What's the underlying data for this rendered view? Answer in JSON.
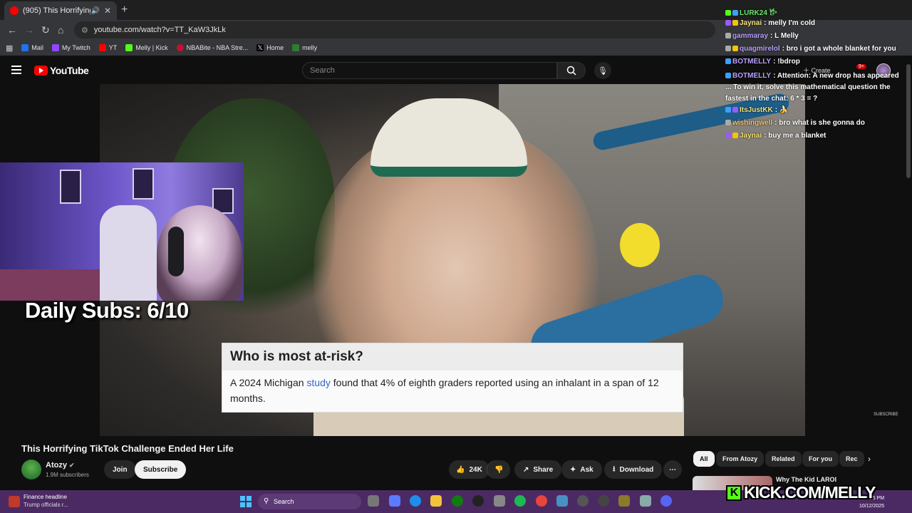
{
  "browser": {
    "tab_title": "(905) This Horrifying TikTok",
    "new_tab": "+",
    "url": "youtube.com/watch?v=TT_KaW3JkLk",
    "bookmarks": [
      "Mail",
      "My Twitch",
      "YT",
      "Melly | Kick",
      "NBABite - NBA Stre...",
      "Home",
      "melly"
    ]
  },
  "youtube": {
    "logo": "YouTube",
    "search_placeholder": "Search",
    "create_label": "Create",
    "notif_count": "9+"
  },
  "video": {
    "card_title": "Who is most at-risk?",
    "card_text_before": "A 2024 Michigan ",
    "card_link": "study",
    "card_text_after": " found that 4% of eighth graders reported using an inhalant in a span of 12 months.",
    "subscribe_tag": "SUBSCRIBE"
  },
  "overlay": {
    "daily_subs": "Daily Subs: 6/10",
    "kick_url": "KICK.COM/MELLY"
  },
  "chat": [
    {
      "user": "LURK24",
      "msg": "",
      "color": "#6fe36f"
    },
    {
      "user": "Jaynai",
      "msg": "melly I'm cold",
      "color": "#f6e27a"
    },
    {
      "user": "gammaray",
      "msg": "L Melly",
      "color": "#b8a0ff"
    },
    {
      "user": "quagmirelol",
      "msg": "bro i got a whole blanket for you",
      "color": "#b8a0ff"
    },
    {
      "user": "BOTMELLY",
      "msg": "!bdrop",
      "color": "#b8a0ff"
    },
    {
      "user": "BOTMELLY",
      "msg": "Attention: A new drop has appeared ... To win it, solve this mathematical question the fastest in the chat: 6 * 3 = ?",
      "color": "#b8a0ff"
    },
    {
      "user": "ItsJustKK",
      "msg": "",
      "color": "#f6e27a"
    },
    {
      "user": "wishingwell",
      "msg": "bro what is she gonna do",
      "color": "#f6c27a"
    },
    {
      "user": "Jaynai",
      "msg": "buy me a blanket",
      "color": "#f6e27a"
    }
  ],
  "meta": {
    "title": "This Horrifying TikTok Challenge Ended Her Life",
    "channel": "Atozy",
    "subscribers": "1.9M subscribers",
    "join": "Join",
    "subscribe": "Subscribe",
    "likes": "24K",
    "share": "Share",
    "ask": "Ask",
    "download": "Download",
    "more": "⋯"
  },
  "chips": [
    "All",
    "From Atozy",
    "Related",
    "For you",
    "Rec"
  ],
  "recommendation": {
    "title": "Why The Kid LAROI"
  },
  "taskbar": {
    "news_title": "Finance headline",
    "news_sub": "Trump officials r...",
    "search": "Search",
    "time": "35 PM",
    "date": "10/12/2025"
  }
}
